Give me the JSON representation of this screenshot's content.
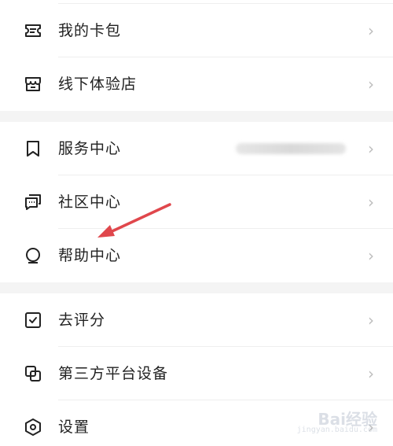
{
  "menu": {
    "group1": [
      {
        "label": "我的卡包",
        "icon": "card-wallet-icon"
      },
      {
        "label": "线下体验店",
        "icon": "store-icon"
      }
    ],
    "group2": [
      {
        "label": "服务中心",
        "icon": "bookmark-icon"
      },
      {
        "label": "社区中心",
        "icon": "chat-bubbles-icon"
      },
      {
        "label": "帮助中心",
        "icon": "help-headset-icon"
      }
    ],
    "group3": [
      {
        "label": "去评分",
        "icon": "check-square-icon"
      },
      {
        "label": "第三方平台设备",
        "icon": "linked-devices-icon"
      },
      {
        "label": "设置",
        "icon": "settings-hexagon-icon"
      }
    ],
    "chevron": "›"
  },
  "watermark": {
    "brand": "Bai经验",
    "url": "jingyan.baidu.com"
  },
  "colors": {
    "arrow": "#e0474c",
    "divider": "#eeeeee",
    "section_gap": "#f4f4f4"
  }
}
